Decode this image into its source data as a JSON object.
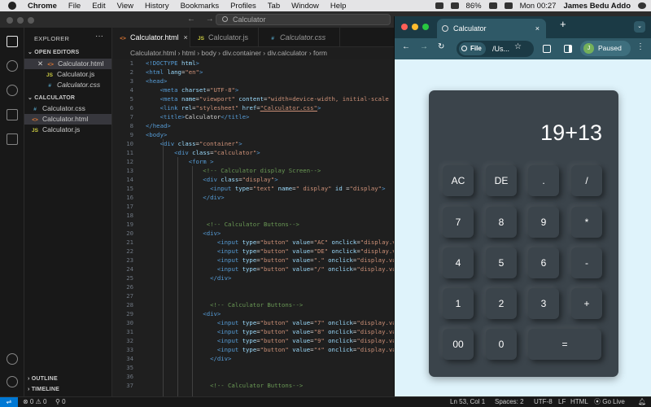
{
  "menubar": {
    "app": "Chrome",
    "items": [
      "File",
      "Edit",
      "View",
      "History",
      "Bookmarks",
      "Profiles",
      "Tab",
      "Window",
      "Help"
    ],
    "battery": "86%",
    "clock": "Mon 00:27",
    "user": "James Bedu Addo"
  },
  "vscode": {
    "search": "Calculator",
    "explorer_label": "EXPLORER",
    "open_editors_label": "OPEN EDITORS",
    "open_editors": [
      {
        "name": "Calculator.html",
        "type": "html",
        "close": "✕"
      },
      {
        "name": "Calculator.js",
        "type": "js"
      },
      {
        "name": "Calculator.css",
        "type": "css"
      }
    ],
    "folder_label": "CALCULATOR",
    "folder_files": [
      {
        "name": "Calculator.css",
        "type": "css"
      },
      {
        "name": "Calculator.html",
        "type": "html"
      },
      {
        "name": "Calculator.js",
        "type": "js"
      }
    ],
    "outline_label": "OUTLINE",
    "timeline_label": "TIMELINE",
    "tabs": [
      {
        "label": "Calculator.html",
        "icon": "<>",
        "close": "×"
      },
      {
        "label": "Calculator.js",
        "icon": "JS"
      },
      {
        "label": "Calculator.css",
        "icon": "#"
      }
    ],
    "breadcrumb": "Calculator.html › html › body › div.container › div.calculator › form",
    "line_numbers": [
      "1",
      "2",
      "3",
      "4",
      "5",
      "6",
      "7",
      "8",
      "9",
      "10",
      "11",
      "12",
      "13",
      "14",
      "15",
      "16",
      "17",
      "18",
      "19",
      "20",
      "21",
      "22",
      "23",
      "24",
      "25",
      "26",
      "27",
      "28",
      "29",
      "30",
      "31",
      "32",
      "33",
      "34",
      "35",
      "36",
      "37"
    ],
    "status": {
      "problems": "⊗ 0 ⚠ 0",
      "ports": "⚲ 0",
      "position": "Ln 53, Col 1",
      "spaces": "Spaces: 2",
      "encoding": "UTF-8",
      "eol": "LF",
      "language": "HTML",
      "golive": "Go Live"
    }
  },
  "browser": {
    "tab_title": "Calculator",
    "tab_close": "×",
    "file_chip": "File",
    "url": "/Us...",
    "profile": "Paused",
    "profile_initial": "J",
    "nav": {
      "back": "←",
      "forward": "→",
      "reload": "↻",
      "new_tab": "+",
      "dropdown": "⌄",
      "star": "☆",
      "menu": "⋮"
    }
  },
  "calculator": {
    "display_value": "19+13",
    "keys": [
      [
        "AC",
        "DE",
        ".",
        "/"
      ],
      [
        "7",
        "8",
        "9",
        "*"
      ],
      [
        "4",
        "5",
        "6",
        "-"
      ],
      [
        "1",
        "2",
        "3",
        "+"
      ],
      [
        "00",
        "0",
        "="
      ]
    ]
  },
  "colors": {
    "editor_bg": "#1f1f1f",
    "calc_body": "#3b444b",
    "page_bg": "#dff3fb",
    "chrome_frame": "#2f5967",
    "status_remote": "#0078d4"
  }
}
